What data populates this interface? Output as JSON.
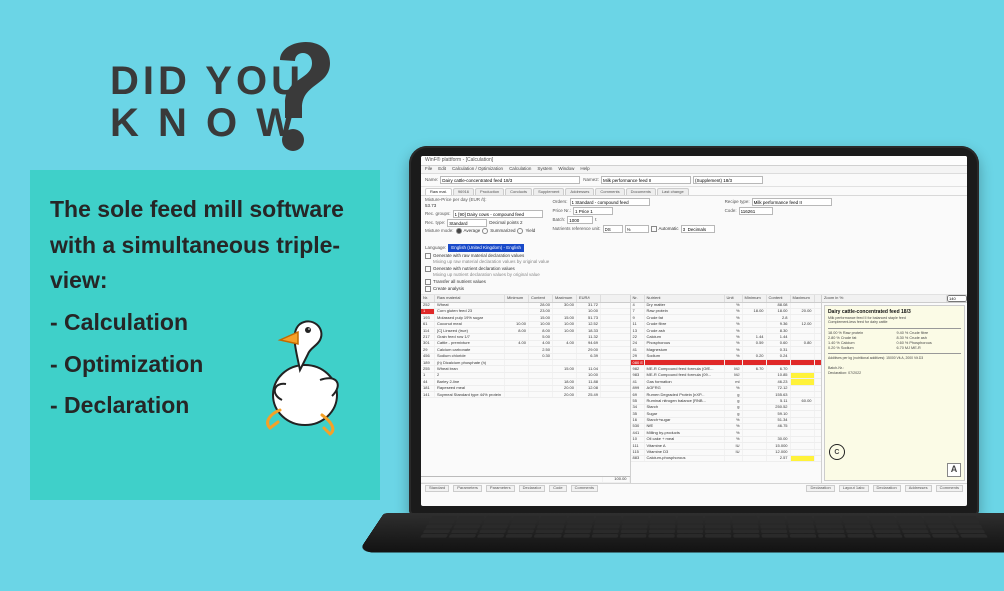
{
  "headline": {
    "line1": "DID YOU",
    "line2": "K N O W"
  },
  "panel": {
    "lead": "The sole feed mill software with a simultaneous triple-view:",
    "b1": "- Calculation",
    "b2": "- Optimization",
    "b3": "- Declaration"
  },
  "app": {
    "title": "WinF® plattform - [Calculation]",
    "menu": [
      "File",
      "Edit",
      "Calculation / Optimization",
      "Calculation",
      "System",
      "Window",
      "Help"
    ],
    "name_label": "Name:",
    "name_value": "Dairy cattle-concentrated feed 18/3",
    "name2_label": "Name2:",
    "name2_value": "Milk performance feed II",
    "name2_extra": "(Supplement) 18/3",
    "tabs": [
      "Raw mat.",
      "96916",
      "Production",
      "Conducts",
      "Supplement",
      "Addresses",
      "Comments",
      "Documents",
      "Last change"
    ],
    "price_label": "Mixture-Price per day (EUR /t):",
    "price_val": "53.73",
    "group_label": "Rec. groups:",
    "group_val": "1 [90] Dairy cows - compound feed",
    "type_label": "Rec. type:",
    "type_val": "Standard",
    "type_decimal": "Decimal points 2",
    "order_label": "Orders:",
    "order_val": "1 Standard - compound feed",
    "price1_label": "Price Nr.:",
    "price1_val": "1 Price 1",
    "batch_label": "Batch:",
    "batch_val": "1000",
    "batch_unit": "t",
    "recipe_label": "Recipe type:",
    "recipe_val": "Milk performance feed II",
    "code_label": "Code:",
    "code_val": "116261",
    "lang_label": "Language:",
    "lang_val": "English (United Kingdom) - English",
    "mix_label": "Mixture mode:",
    "mix_avg": "Average",
    "mix_sum": "Summarized",
    "mix_yield": "Yield",
    "nut_label": "Nutrients reference unit:",
    "nut_val": "DS",
    "nut_pct": "%",
    "auto": "Automatic",
    "dec_fld": "3  Decimals",
    "opt1": "Generate with raw material declaration values",
    "opt1b": "Mixing up raw material declaration values by original value",
    "opt2": "Generate with nutrient declaration values",
    "opt2b": "Mixing up nutrient declaration values by original value",
    "opt3": "Transfer all nutrient values",
    "opt4": "Create analysis",
    "left_head": [
      "Nr.",
      "Raw material",
      "Minimum",
      "Content",
      "Maximum",
      "EUR/t"
    ],
    "left_rows": [
      {
        "cls": "",
        "c": [
          "252",
          "Wheat",
          "",
          "28.00",
          "30.00",
          "31.72"
        ]
      },
      {
        "cls": "red",
        "c": [
          "1",
          "Corn gluten feed 23",
          "",
          "23.00",
          "",
          "10.00"
        ]
      },
      {
        "cls": "",
        "c": [
          "193",
          "Molassed pulp 19% sugar",
          "",
          "15.00",
          "15.00",
          "51.73"
        ]
      },
      {
        "cls": "",
        "c": [
          "61",
          "Coconut meal",
          "10.00",
          "10.00",
          "10.00",
          "12.52"
        ]
      },
      {
        "cls": "",
        "c": [
          "114",
          "[C] Linseed (true)",
          "8.00",
          "8.00",
          "10.00",
          "18.33"
        ]
      },
      {
        "cls": "",
        "c": [
          "217",
          "Grain feed row 1/7",
          "",
          "5.00",
          "",
          "11.32"
        ]
      },
      {
        "cls": "",
        "c": [
          "301",
          "Cattle - premixture",
          "4.00",
          "4.00",
          "4.00",
          "94.69"
        ]
      },
      {
        "cls": "",
        "c": [
          "29",
          "Calcium carbonate",
          "",
          "2.50",
          "",
          "29.00"
        ]
      },
      {
        "cls": "",
        "c": [
          "456",
          "Sodium chloride",
          "",
          "0.30",
          "",
          "6.39"
        ]
      },
      {
        "cls": "",
        "c": [
          "189",
          "(h) Dicalcium phosphate (h)",
          "",
          "",
          "",
          ""
        ]
      },
      {
        "cls": "",
        "c": [
          "255",
          "Wheat bran",
          "",
          "",
          "15.00",
          "11.04"
        ]
      },
      {
        "cls": "",
        "c": [
          "1",
          "2",
          "",
          "",
          "",
          "10.00"
        ]
      },
      {
        "cls": "",
        "c": [
          "44",
          "Barley 2-line",
          "",
          "",
          "18.00",
          "11.88"
        ]
      },
      {
        "cls": "",
        "c": [
          "181",
          "Rapeseed meal",
          "",
          "",
          "20.00",
          "12.08"
        ]
      },
      {
        "cls": "",
        "c": [
          "141",
          "Soymeal Standard type 44% protein",
          "",
          "",
          "20.00",
          "25.49"
        ]
      }
    ],
    "left_total": "100.00",
    "mid_head": [
      "Nr.",
      "Nutrient",
      "Unit",
      "Minimum",
      "Content",
      "Maximum"
    ],
    "mid_rows": [
      {
        "cls": "",
        "c": [
          "4",
          "Dry matter",
          "%",
          "",
          "88.08",
          ""
        ]
      },
      {
        "cls": "",
        "c": [
          "7",
          "Raw protein",
          "%",
          "18.00",
          "18.00",
          "20.00"
        ]
      },
      {
        "cls": "",
        "c": [
          "9",
          "Crude fat",
          "%",
          "",
          "2.8",
          ""
        ]
      },
      {
        "cls": "",
        "c": [
          "11",
          "Crude fibre",
          "%",
          "",
          "9.36",
          "12.00"
        ]
      },
      {
        "cls": "",
        "c": [
          "13",
          "Crude ash",
          "%",
          "",
          "8.30",
          ""
        ]
      },
      {
        "cls": "",
        "c": [
          "22",
          "Calcium",
          "%",
          "1.44",
          "1.44",
          ""
        ]
      },
      {
        "cls": "",
        "c": [
          "24",
          "Phosphorous",
          "%",
          "0.59",
          "0.60",
          "0.80"
        ]
      },
      {
        "cls": "",
        "c": [
          "41",
          "Magnesium",
          "%",
          "",
          "0.31",
          ""
        ]
      },
      {
        "cls": "",
        "c": [
          "29",
          "Sodium",
          "%",
          "0.20",
          "0.24",
          ""
        ]
      },
      {
        "cls": "redfull",
        "c": [
          "080 E",
          "",
          "",
          "",
          "",
          ""
        ]
      },
      {
        "cls": "",
        "c": [
          "982",
          "ME-R Compound feed formula (GfE...",
          "MJ",
          "6.70",
          "6.70",
          ""
        ]
      },
      {
        "cls": "yel",
        "c": [
          "983",
          "ME-R Compound feed formula (09...",
          "MJ",
          "",
          "10.85",
          ""
        ]
      },
      {
        "cls": "yel",
        "c": [
          "41",
          "Gas formation",
          "ml",
          "",
          "46.23",
          ""
        ]
      },
      {
        "cls": "",
        "c": [
          "899",
          "AGFRG",
          "%",
          "",
          "72.12",
          ""
        ]
      },
      {
        "cls": "",
        "c": [
          "69",
          "Rumen Degraded Protein [nXP...",
          "g",
          "",
          "155.63",
          ""
        ]
      },
      {
        "cls": "",
        "c": [
          "55",
          "Ruminal nitrogen balance [RNB...",
          "g",
          "",
          "5.11",
          "60.00"
        ]
      },
      {
        "cls": "",
        "c": [
          "34",
          "Starch",
          "g",
          "",
          "250.52",
          ""
        ]
      },
      {
        "cls": "",
        "c": [
          "35",
          "Sugar",
          "g",
          "",
          "59.10",
          ""
        ]
      },
      {
        "cls": "",
        "c": [
          "16",
          "Starch+sugar",
          "%",
          "",
          "51.34",
          ""
        ]
      },
      {
        "cls": "",
        "c": [
          "530",
          "NfE",
          "%",
          "",
          "46.75",
          ""
        ]
      },
      {
        "cls": "",
        "c": [
          "441",
          "Milling by-products",
          "%",
          "",
          "",
          ""
        ]
      },
      {
        "cls": "",
        "c": [
          "10",
          "Oil cake + meal",
          "%",
          "",
          "30.00",
          ""
        ]
      },
      {
        "cls": "",
        "c": [
          "111",
          "Vitamine A",
          "IU",
          "",
          "15.000",
          ""
        ]
      },
      {
        "cls": "",
        "c": [
          "115",
          "Vitamine D3",
          "IU",
          "",
          "12.000",
          ""
        ]
      },
      {
        "cls": "yel",
        "c": [
          "883",
          "Calcium-phosphorous",
          "",
          "",
          "2.57",
          ""
        ]
      }
    ],
    "decl": {
      "zoom_label": "Zoom in %:",
      "zoom_val": "140",
      "title": "Dairy cattle-concentrated feed 18/3",
      "subtitle": "Milk performance feed II for balanced staple feed",
      "subtitle2": "Complement-less feed for dairy cattle",
      "rows": [
        "18.00 % Raw protein",
        "9.40 % Crude fibre",
        "2.80 % Crude fat",
        "8.30 % Crude ash",
        "1.40 % Calcium",
        "0.60 % Phosphorous",
        "0.20 % Sodium",
        "6.70 MJ ME-R"
      ],
      "footer": "Additives per kg (nutritional additives): 15000 Vit.A, 2000 Vit.D3",
      "batch": "Batch-Nr.:",
      "date": "Declaration: 07/2022",
      "logo": "A"
    },
    "bottabs": [
      "Standard",
      "Parameters",
      "Parameters",
      "Declarator",
      "Code",
      "Comments"
    ],
    "bottabs_right": [
      "Declaration",
      "Layout 1abc",
      "Declaration",
      "Addresses",
      "Comments"
    ]
  }
}
